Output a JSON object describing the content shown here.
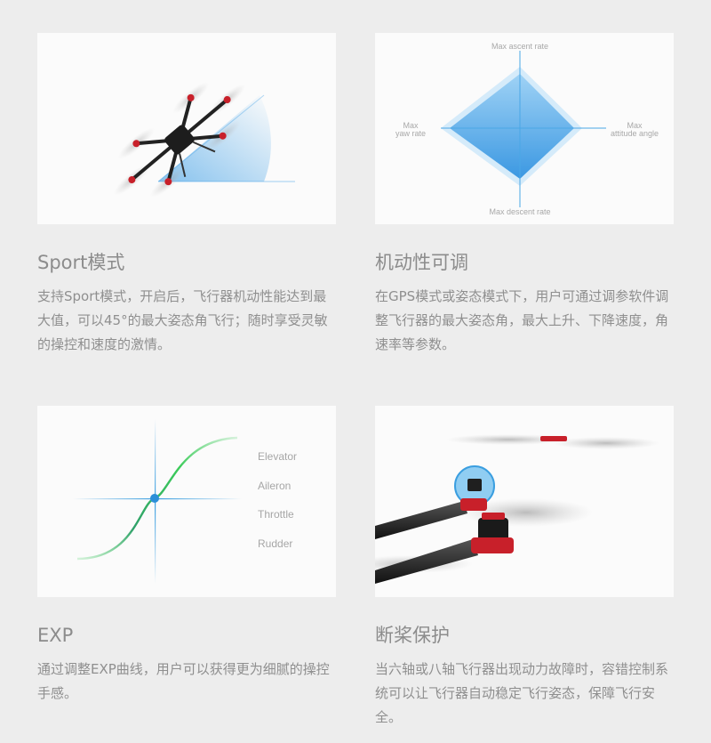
{
  "features": [
    {
      "title": "Sport模式",
      "description": "支持Sport模式，开启后，飞行器机动性能达到最大值，可以45°的最大姿态角飞行；随时享受灵敏的操控和速度的激情。",
      "image": "drone-tilted-illustration"
    },
    {
      "title": "机动性可调",
      "description": "在GPS模式或姿态模式下，用户可通过调参软件调整飞行器的最大姿态角，最大上升、下降速度，角速率等参数。",
      "image": "parameter-radar-diagram",
      "diagram_labels": {
        "top": "Max ascent rate",
        "bottom": "Max descent rate",
        "left_line1": "Max",
        "left_line2": "yaw rate",
        "right_line1": "Max",
        "right_line2": "attitude angle"
      }
    },
    {
      "title": "EXP",
      "description": "通过调整EXP曲线，用户可以获得更为细腻的操控手感。",
      "image": "exp-curve-diagram",
      "diagram_labels": [
        "Elevator",
        "Aileron",
        "Throttle",
        "Rudder"
      ]
    },
    {
      "title": "断桨保护",
      "description": "当六轴或八轴飞行器出现动力故障时，容错控制系统可以让飞行器自动稳定飞行姿态，保障飞行安全。",
      "image": "motor-arm-closeup"
    }
  ],
  "colors": {
    "background": "#ededed",
    "accent_blue": "#3a9ee0",
    "accent_green": "#3ccc5a",
    "motor_red": "#c8202a"
  }
}
